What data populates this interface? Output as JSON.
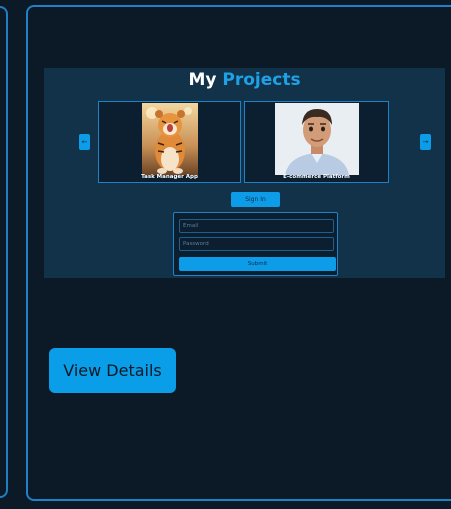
{
  "section": {
    "title_main": "My",
    "title_accent": "Projects"
  },
  "carousel": {
    "prev_label": "←",
    "next_label": "→",
    "cards": [
      {
        "caption": "Task Manager App"
      },
      {
        "caption": "E-commerce Platform"
      }
    ]
  },
  "auth": {
    "signin_label": "Sign In",
    "email_placeholder": "Email",
    "password_placeholder": "Password",
    "submit_label": "Submit"
  },
  "cta": {
    "view_details_label": "View Details"
  },
  "colors": {
    "background": "#0b1a26",
    "panel": "#12324a",
    "accent": "#1fa1e6",
    "button": "#0d9ce8",
    "border": "#1f82c6"
  }
}
